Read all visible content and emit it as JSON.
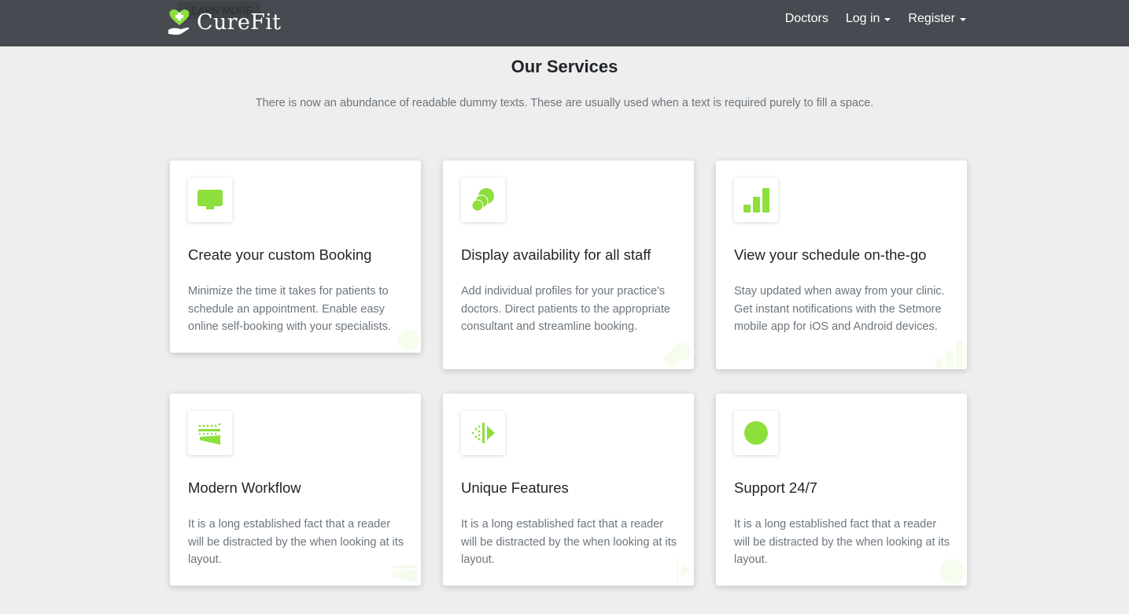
{
  "navbar": {
    "brand": "CureFit",
    "ghost_button": "LEARN MORE",
    "links": [
      {
        "label": "Doctors",
        "dropdown": false
      },
      {
        "label": "Log in",
        "dropdown": true
      },
      {
        "label": "Register",
        "dropdown": true
      }
    ]
  },
  "section": {
    "title": "Our Services",
    "subtitle": "There is now an abundance of readable dummy texts. These are usually used when a text is required purely to fill a space."
  },
  "accent_color": "#8ddf3c",
  "cards": [
    {
      "icon": "monitor-icon",
      "title": "Create your custom Booking",
      "description": "Minimize the time it takes for patients to schedule an appointment. Enable easy online self-booking with your specialists."
    },
    {
      "icon": "circles-icon",
      "title": "Display availability for all staff",
      "description": "Add individual profiles for your practice's doctors. Direct patients to the appropriate consultant and streamline booking."
    },
    {
      "icon": "signal-bars-icon",
      "title": "View your schedule on-the-go",
      "description": "Stay updated when away from your clinic. Get instant notifications with the Setmore mobile app for iOS and Android devices."
    },
    {
      "icon": "workflow-icon",
      "title": "Modern Workflow",
      "description": "It is a long established fact that a reader will be distracted by the when looking at its layout."
    },
    {
      "icon": "features-icon",
      "title": "Unique Features",
      "description": "It is a long established fact that a reader will be distracted by the when looking at its layout."
    },
    {
      "icon": "support-icon",
      "title": "Support 24/7",
      "description": "It is a long established fact that a reader will be distracted by the when looking at its layout."
    }
  ]
}
